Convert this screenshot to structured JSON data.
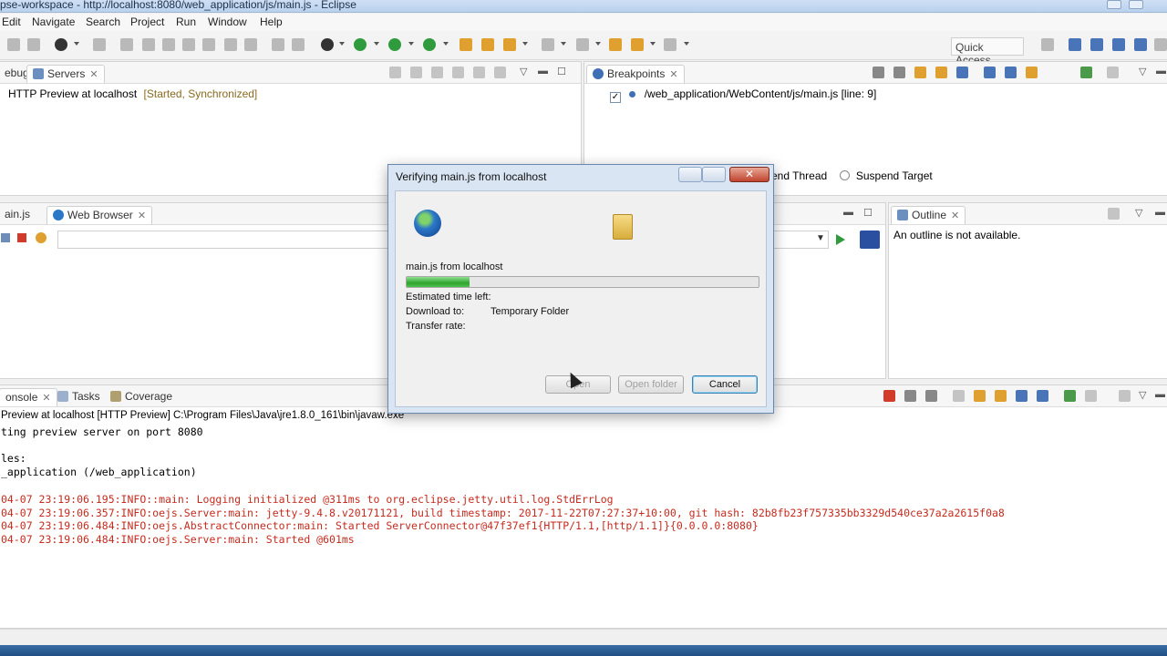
{
  "window": {
    "title": "pse-workspace - http://localhost:8080/web_application/js/main.js - Eclipse"
  },
  "menu": [
    "Edit",
    "Navigate",
    "Search",
    "Project",
    "Run",
    "Window",
    "Help"
  ],
  "toolbar": {
    "quick_access": "Quick Access"
  },
  "servers_panel": {
    "tabs": [
      "ebug",
      "Servers"
    ],
    "server_name": "HTTP Preview at localhost",
    "server_status": "[Started, Synchronized]"
  },
  "breakpoints_panel": {
    "tab": "Breakpoints",
    "entry": "/web_application/WebContent/js/main.js [line: 9]",
    "suspend_thread": "end Thread",
    "suspend_target": "Suspend Target"
  },
  "editor_panel": {
    "tabs": [
      "ain.js",
      "Web Browser"
    ]
  },
  "outline_panel": {
    "tab": "Outline",
    "message": "An outline is not available."
  },
  "console_panel": {
    "tabs": [
      "onsole",
      "Tasks",
      "Coverage"
    ],
    "header": "Preview at localhost [HTTP Preview] C:\\Program Files\\Java\\jre1.8.0_161\\bin\\javaw.exe",
    "lines": [
      {
        "text": "ting preview server on port 8080",
        "color": "black"
      },
      {
        "text": "",
        "color": "black"
      },
      {
        "text": "les:",
        "color": "black"
      },
      {
        "text": "_application (/web_application)",
        "color": "black"
      },
      {
        "text": "",
        "color": "black"
      },
      {
        "text": "04-07 23:19:06.195:INFO::main: Logging initialized @311ms to org.eclipse.jetty.util.log.StdErrLog",
        "color": "red"
      },
      {
        "text": "04-07 23:19:06.357:INFO:oejs.Server:main: jetty-9.4.8.v20171121, build timestamp: 2017-11-22T07:27:37+10:00, git hash: 82b8fb23f757335bb3329d540ce37a2a2615f0a8",
        "color": "red"
      },
      {
        "text": "04-07 23:19:06.484:INFO:oejs.AbstractConnector:main: Started ServerConnector@47f37ef1{HTTP/1.1,[http/1.1]}{0.0.0.0:8080}",
        "color": "red"
      },
      {
        "text": "04-07 23:19:06.484:INFO:oejs.Server:main: Started @601ms",
        "color": "red"
      }
    ]
  },
  "dialog": {
    "title": "Verifying main.js from localhost",
    "file_label": "main.js from localhost",
    "progress": 0.18,
    "estimated_label": "Estimated time left:",
    "download_to_label": "Download to:",
    "download_to_value": "Temporary Folder",
    "transfer_rate_label": "Transfer rate:",
    "open_button": "Open",
    "open_folder_button": "Open folder",
    "cancel_button": "Cancel"
  },
  "colors": {
    "accent": "#3c7fb1",
    "console_error": "#c62b1f",
    "progress": "#2ea52e"
  }
}
